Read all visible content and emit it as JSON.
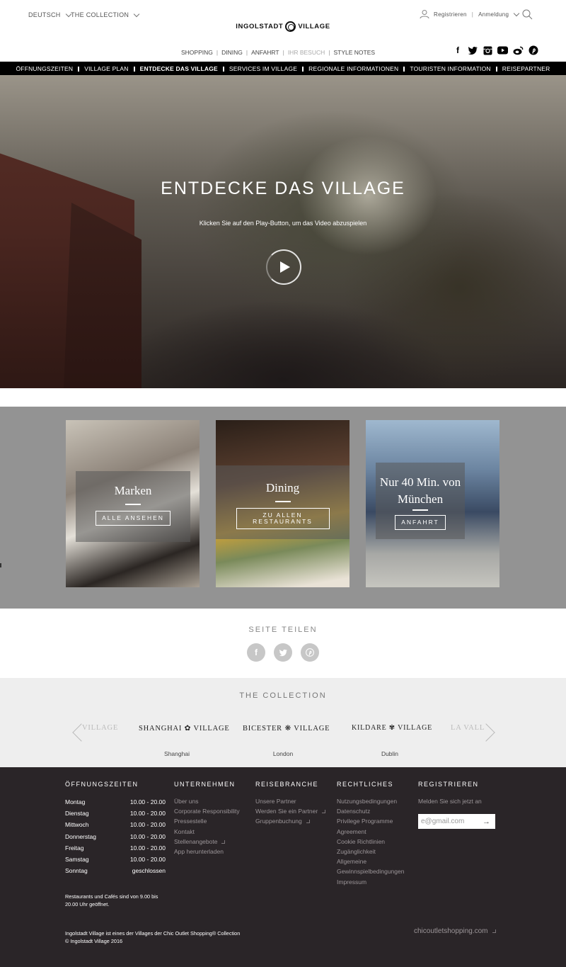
{
  "header": {
    "language": "DEUTSCH",
    "collection": "THE COLLECTION",
    "logo_text_left": "INGOLSTADT",
    "logo_text_right": "VILLAGE",
    "register": "Registrieren",
    "login": "Anmeldung",
    "main_nav": [
      "SHOPPING",
      "DINING",
      "ANFAHRT",
      "IHR BESUCH",
      "STYLE NOTES"
    ],
    "social_icons": [
      "facebook-icon",
      "twitter-icon",
      "instagram-icon",
      "youtube-icon",
      "weibo-icon",
      "pinterest-icon"
    ]
  },
  "subnav": [
    "ÖFFNUNGSZEITEN",
    "VILLAGE PLAN",
    "ENTDECKE DAS VILLAGE",
    "SERVICES IM VILLAGE",
    "REGIONALE INFORMATIONEN",
    "TOURISTEN INFORMATION",
    "REISEPARTNER"
  ],
  "hero": {
    "title": "ENTDECKE DAS VILLAGE",
    "subtitle": "Klicken Sie auf den Play-Button, um das Video abzuspielen"
  },
  "cards": [
    {
      "title": "Marken",
      "button": "ALLE ANSEHEN"
    },
    {
      "title": "Dining",
      "button": "ZU ALLEN RESTAURANTS"
    },
    {
      "title": "Nur 40 Min. von München",
      "button": "ANFAHRT"
    }
  ],
  "share": {
    "title": "SEITE TEILEN"
  },
  "collection": {
    "title": "THE COLLECTION",
    "partial_left": "VILLAGE",
    "villages": [
      {
        "logo_left": "SHANGHAI",
        "logo_right": "VILLAGE",
        "city": "Shanghai"
      },
      {
        "logo_left": "BICESTER",
        "logo_right": "VILLAGE",
        "city": "London"
      },
      {
        "logo_left": "KILDARE",
        "logo_right": "VILLAGE",
        "city": "Dublin"
      }
    ],
    "partial_right": "LA VALL"
  },
  "footer": {
    "hours": {
      "title": "ÖFFNUNGSZEITEN",
      "rows": [
        {
          "day": "Montag",
          "time": "10.00 - 20.00"
        },
        {
          "day": "Dienstag",
          "time": "10.00 - 20.00"
        },
        {
          "day": "Mittwoch",
          "time": "10.00 - 20.00"
        },
        {
          "day": "Donnerstag",
          "time": "10.00 - 20.00"
        },
        {
          "day": "Freitag",
          "time": "10.00 - 20.00"
        },
        {
          "day": "Samstag",
          "time": "10.00 - 20.00"
        },
        {
          "day": "Sonntag",
          "time": "geschlossen"
        }
      ],
      "note": "Restaurants und Cafés sind von 9.00 bis 20.00 Uhr geöffnet."
    },
    "company": {
      "title": "UNTERNEHMEN",
      "links": [
        "Über uns",
        "Corporate Responsibility",
        "Pressestelle",
        "Kontakt",
        "Stellenangebote",
        "App herunterladen"
      ]
    },
    "travel": {
      "title": "REISEBRANCHE",
      "links": [
        "Unsere Partner",
        "Werden Sie ein Partner",
        "Gruppenbuchung"
      ]
    },
    "legal": {
      "title": "RECHTLICHES",
      "links": [
        "Nutzungsbedingungen",
        "Datenschutz",
        "Privilege Programme",
        "Agreement",
        "Cookie Richtlinien",
        "Zugänglichkeit",
        "Allgemeine",
        "Gewinnspielbedingungen",
        "Impressum"
      ]
    },
    "register": {
      "title": "REGISTRIEREN",
      "text": "Melden Sie sich jetzt an",
      "email_value": "e@gmail.com"
    },
    "bottom_line1": "Ingolstadt Village ist eines der Villages der Chic Outlet Shopping® Collection",
    "bottom_line2": "© Ingolstadt Village 2016",
    "site_link": "chicoutletshopping.com"
  }
}
